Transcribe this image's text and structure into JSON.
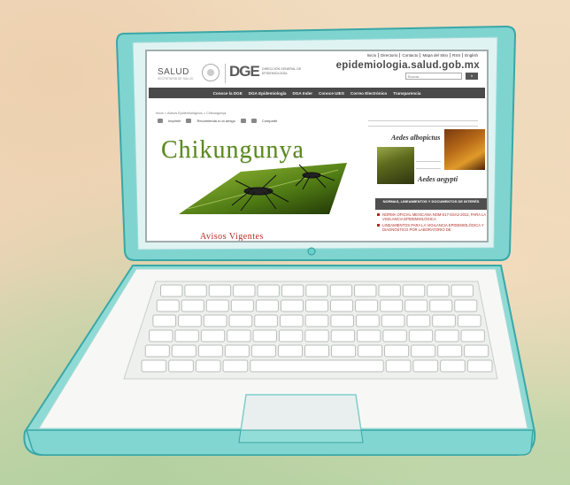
{
  "colors": {
    "laptop_frame": "#7fd4d0",
    "title_green": "#5a8a1c",
    "notice_red": "#b52a1f",
    "nav_bg": "#4a4a4a"
  },
  "site": {
    "top_links": [
      "Inicio",
      "Directorio",
      "Contacto",
      "Mapa del Sitio",
      "RSS",
      "English"
    ],
    "salud_logo": "SALUD",
    "salud_sub": "SECRETARÍA DE SALUD",
    "dge_logo": "DGE",
    "dge_text": "DIRECCIÓN GENERAL DE EPIDEMIOLOGÍA",
    "domain": "epidemiologia.salud.gob.mx",
    "search_placeholder": "Buscar...",
    "search_button": "Ir",
    "nav": [
      "Conoce la DGE",
      "DGA Epidemiología",
      "DGA Inder",
      "Conoce UIES",
      "Correo Electrónico",
      "Transparencia"
    ],
    "breadcrumb": "Inicio > Avisos Epidemiológicos > Chikungunya",
    "tools": {
      "print": "Imprimir",
      "recommend": "Recomienda a un amigo",
      "share": "Compartir"
    },
    "title": "Chikungunya",
    "notices": "Avisos Vigentes",
    "sidebar": {
      "aedes1": "Aedes albopictus",
      "aedes2": "Aedes aegypti",
      "norm_header": "NORMAS, LINEAMIENTOS Y DOCUMENTOS DE INTERÉS",
      "items": [
        "NORMA OFICIAL MEXICANA NOM-017-SSA2-2012, PARA LA VIGILANCIA EPIDEMIOLÓGICA",
        "LINEAMIENTOS PARA LA VIGILANCIA EPIDEMIOLÓGICA Y DIAGNÓSTICO POR LABORATORIO DE"
      ]
    }
  }
}
